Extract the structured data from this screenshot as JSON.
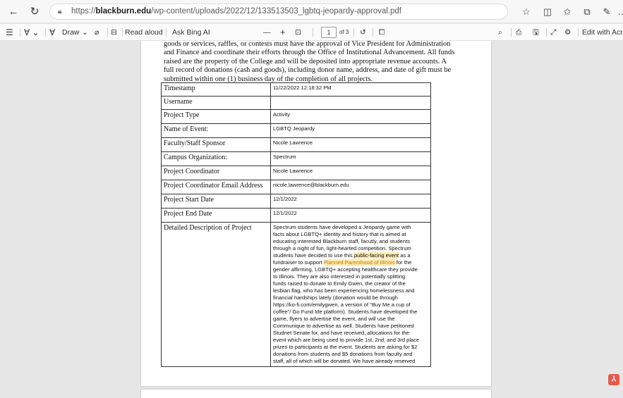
{
  "browser": {
    "url_prefix": "https://",
    "url_host": "blackburn.edu",
    "url_path": "/wp-content/uploads/2022/12/133513503_lgbtq-jeopardy-approval.pdf"
  },
  "pdf_toolbar": {
    "draw_label": "Draw",
    "read_aloud": "Read aloud",
    "ask_bing": "Ask Bing AI",
    "zoom_out": "—",
    "zoom_in": "+",
    "page_current": "1",
    "page_total": "of 3",
    "edit_label": "Edit with Acroba"
  },
  "document": {
    "intro_lines": [
      "goods or services, raffles, or contests must have the approval of Vice President for Administration",
      "and Finance and coordinate their efforts through the Office of Institutional Advancement. All funds",
      "raised are the property of the College and will be deposited into appropriate revenue accounts. A",
      "full record of donations (cash and goods), including donor name, address, and date of gift must be",
      "submitted within one (1) business day of the completion of all projects."
    ],
    "rows": [
      {
        "label": "Timestamp",
        "value": "11/22/2022 12:18:32 PM"
      },
      {
        "label": "Username",
        "value": ""
      },
      {
        "label": "Project Type",
        "value": "Activity"
      },
      {
        "label": "Name of Event:",
        "value": "LGBTQ Jeopardy"
      },
      {
        "label": "Faculty/Staff Sponsor",
        "value": "Nicole Lawrence"
      },
      {
        "label": "Campus Organization:",
        "value": "Spectrum"
      },
      {
        "label": "Project Coordinator",
        "value": "Nicole Lawrence"
      },
      {
        "label": "Project Coordinator Email Address",
        "value": "nicole.lawrence@blackburn.edu"
      },
      {
        "label": "Project Start Date",
        "value": "12/1/2022"
      },
      {
        "label": "Project End Date",
        "value": "12/1/2022"
      }
    ],
    "description_label": "Detailed Description of Project",
    "description": {
      "l1": "Spectrum students have developed a Jeopardy game with",
      "l2": "facts about LGBTQ+ identity and history that is aimed at",
      "l3": "educating interested Blackburn staff, facutly, and students",
      "l4": "through a night of fun, light-hearted competition. Spectrum",
      "l5a": "students have decided to use this ",
      "l5b": "public-facing event",
      "l5c": " as a",
      "l6a": "fundraiser to support ",
      "l6b": "Planned Parenthood of Illinois",
      "l6c": " for the",
      "l7": "gender affirming, LGBTQ+ accepting healthcare they provide",
      "l8": "to Illinois. They are also interested in potentially splitting",
      "l9": "funds raised to donate to Emily Gwen, the creator of the",
      "l10": "lesbian flag, who has been experiencing homelessness and",
      "l11": "financial hardships lately (donation would be through",
      "l12": "https://ko-fi.com/emilygwen, a version of \"Buy Me a cup of",
      "l13": "coffee\"/ Go Fund Me platform). Students have developed the",
      "l14": "game, flyers to advertise the event, and will use the",
      "l15": "Communique to advertise as well. Students have petitioned",
      "l16": "Studnet Senate for, and have  received, allocations for the",
      "l17": "event which are being used to provide 1st, 2nd, and 3rd place",
      "l18": "prizes to participants at the event. Students are asking for $2",
      "l19": "donations from students and $5 donations from faculty and",
      "l20": "staff, all of which will be donated. We have already reserved"
    }
  }
}
